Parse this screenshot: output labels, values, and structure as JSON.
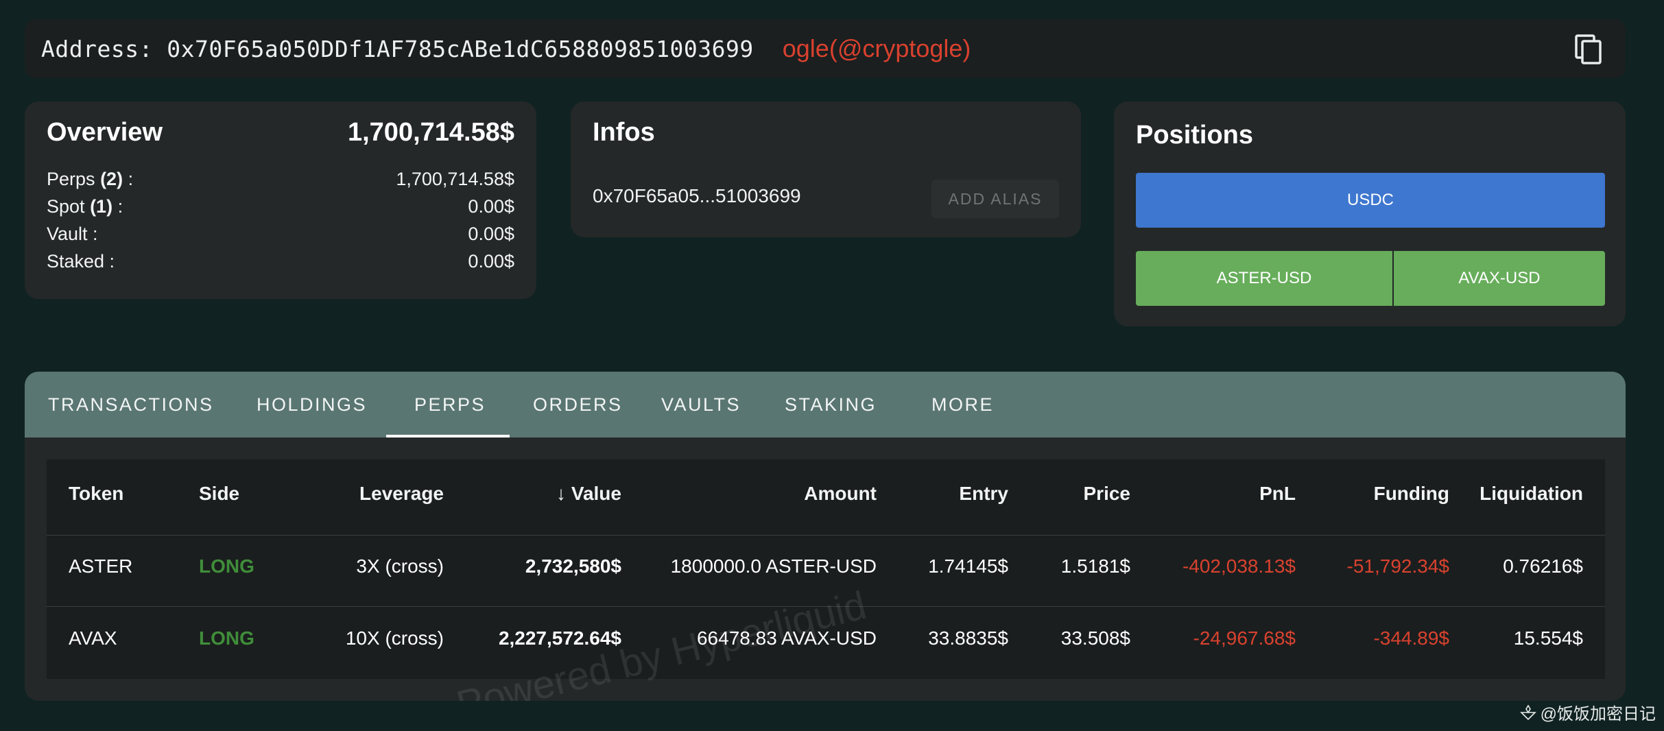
{
  "address_bar": {
    "address_label": "Address: 0x70F65a050DDf1AF785cABe1dC658809851003699",
    "alias": "ogle(@cryptogle)"
  },
  "overview": {
    "title": "Overview",
    "total": "1,700,714.58$",
    "rows": [
      {
        "label": "Perps",
        "count": "(2)",
        "value": "1,700,714.58$"
      },
      {
        "label": "Spot",
        "count": "(1)",
        "value": "0.00$"
      },
      {
        "label": "Vault :",
        "count": "",
        "value": "0.00$"
      },
      {
        "label": "Staked :",
        "count": "",
        "value": "0.00$"
      }
    ]
  },
  "infos": {
    "title": "Infos",
    "short_address": "0x70F65a05...51003699",
    "add_alias_label": "ADD ALIAS"
  },
  "positions": {
    "title": "Positions",
    "buttons": [
      "USDC",
      "ASTER-USD",
      "AVAX-USD"
    ]
  },
  "tabs": [
    "TRANSACTIONS",
    "HOLDINGS",
    "PERPS",
    "ORDERS",
    "VAULTS",
    "STAKING",
    "MORE"
  ],
  "active_tab": "PERPS",
  "table": {
    "headers": [
      "Token",
      "Side",
      "Leverage",
      "Value",
      "Amount",
      "Entry",
      "Price",
      "PnL",
      "Funding",
      "Liquidation"
    ],
    "sort_arrow": "↓",
    "rows": [
      {
        "token": "ASTER",
        "side": "LONG",
        "leverage": "3X (cross)",
        "value": "2,732,580$",
        "amount": "1800000.0 ASTER-USD",
        "entry": "1.74145$",
        "price": "1.5181$",
        "pnl": "-402,038.13$",
        "funding": "-51,792.34$",
        "liquidation": "0.76216$"
      },
      {
        "token": "AVAX",
        "side": "LONG",
        "leverage": "10X (cross)",
        "value": "2,227,572.64$",
        "amount": "66478.83 AVAX-USD",
        "entry": "33.8835$",
        "price": "33.508$",
        "pnl": "-24,967.68$",
        "funding": "-344.89$",
        "liquidation": "15.554$"
      }
    ]
  },
  "watermark": "Powered by Hyperliquid",
  "corner_watermark": "@饭饭加密日记",
  "colors": {
    "background": "#102222",
    "tab_bar": "#5a7672",
    "positive_side": "#3f8e3a",
    "negative": "#d9422f",
    "usdc_button": "#3e77cf",
    "position_button": "#67ad5b"
  }
}
